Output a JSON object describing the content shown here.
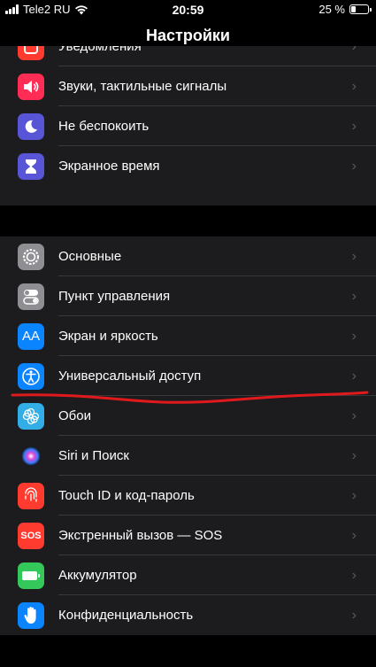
{
  "status": {
    "carrier": "Tele2 RU",
    "time": "20:59",
    "battery_text": "25 %",
    "battery_level": 0.25
  },
  "nav": {
    "title": "Настройки"
  },
  "groups": [
    {
      "items": [
        {
          "label": "Уведомления",
          "icon": "notifications-icon",
          "color": "#ff3b30"
        },
        {
          "label": "Звуки, тактильные сигналы",
          "icon": "sounds-icon",
          "color": "#ff2d55"
        },
        {
          "label": "Не беспокоить",
          "icon": "moon-icon",
          "color": "#5856d6"
        },
        {
          "label": "Экранное время",
          "icon": "hourglass-icon",
          "color": "#5856d6"
        }
      ]
    },
    {
      "items": [
        {
          "label": "Основные",
          "icon": "gear-icon",
          "color": "#8e8e93"
        },
        {
          "label": "Пункт управления",
          "icon": "toggles-icon",
          "color": "#8e8e93"
        },
        {
          "label": "Экран и яркость",
          "icon": "text-size-icon",
          "color": "#0a84ff",
          "glyph": "AA"
        },
        {
          "label": "Универсальный доступ",
          "icon": "accessibility-icon",
          "color": "#0a84ff"
        },
        {
          "label": "Обои",
          "icon": "wallpaper-icon",
          "color": "#32ade6"
        },
        {
          "label": "Siri и Поиск",
          "icon": "siri-icon",
          "color": "#1c1c1e"
        },
        {
          "label": "Touch ID и код-пароль",
          "icon": "fingerprint-icon",
          "color": "#ff3b30"
        },
        {
          "label": "Экстренный вызов — SOS",
          "icon": "sos-icon",
          "color": "#ff3b30",
          "glyph": "SOS"
        },
        {
          "label": "Аккумулятор",
          "icon": "battery-icon",
          "color": "#34c759"
        },
        {
          "label": "Конфиденциальность",
          "icon": "hand-icon",
          "color": "#0a84ff"
        }
      ]
    }
  ],
  "colors": {
    "background": "#000000",
    "cell": "#1c1c1e",
    "separator": "#38383a",
    "annotation": "#e0191c"
  }
}
